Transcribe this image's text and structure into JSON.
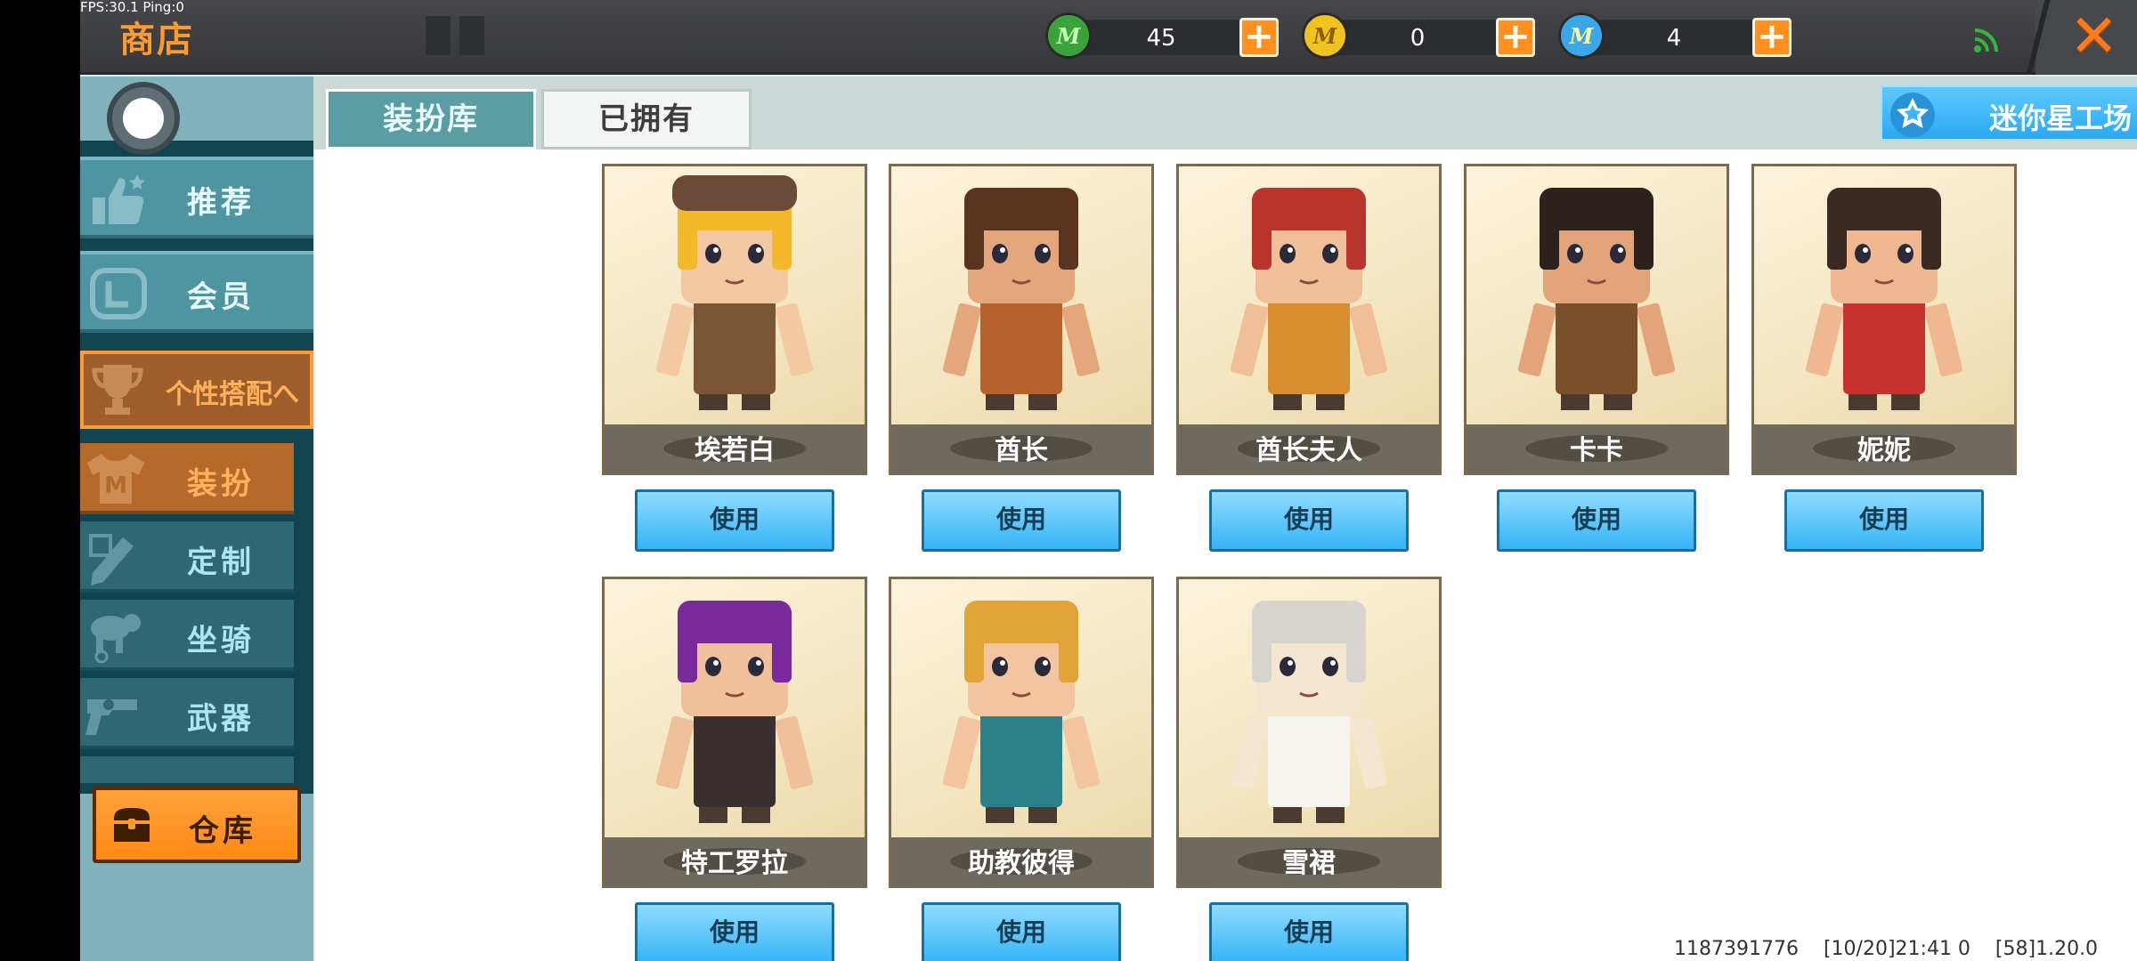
{
  "status": {
    "fps": "FPS:30.1  Ping:0"
  },
  "header": {
    "title": "商店"
  },
  "currencies": [
    {
      "icon": "green-mini-coin-icon",
      "symbol": "M",
      "value": "45",
      "color": "#3aa43a"
    },
    {
      "icon": "gold-mini-coin-icon",
      "symbol": "M",
      "value": "0",
      "color": "#f0c31e"
    },
    {
      "icon": "star-mini-coin-icon",
      "symbol": "M",
      "value": "4",
      "color": "#39a7e8"
    }
  ],
  "sidebar": {
    "recommend": "推荐",
    "member": "会员",
    "personal": "个性搭配へ",
    "sub": {
      "outfit": "装扮",
      "custom": "定制",
      "mount": "坐骑",
      "weapon": "武器"
    },
    "warehouse": "仓库"
  },
  "tabs": {
    "library": "装扮库",
    "owned": "已拥有"
  },
  "workshop": {
    "label": "迷你星工场"
  },
  "use_label": "使用",
  "skins": [
    {
      "name": "埃若白",
      "hair": "#f3b928",
      "outfit": "#7a5636",
      "skin": "#f3c9a3",
      "hat": "#6b4a3a"
    },
    {
      "name": "酋长",
      "hair": "#5a3421",
      "outfit": "#b5622c",
      "skin": "#e4a77c",
      "hat": ""
    },
    {
      "name": "酋长夫人",
      "hair": "#b8342c",
      "outfit": "#d88d2e",
      "skin": "#f0bf98",
      "hat": ""
    },
    {
      "name": "卡卡",
      "hair": "#2c221d",
      "outfit": "#7a4f2c",
      "skin": "#e4a47a",
      "hat": ""
    },
    {
      "name": "妮妮",
      "hair": "#3a2a22",
      "outfit": "#c8322e",
      "skin": "#f0b890",
      "hat": ""
    },
    {
      "name": "特工罗拉",
      "hair": "#7a2a9a",
      "outfit": "#3a2f2f",
      "skin": "#f0c09a",
      "hat": ""
    },
    {
      "name": "助教彼得",
      "hair": "#e0a438",
      "outfit": "#2b7f88",
      "skin": "#f2c5a0",
      "hat": ""
    },
    {
      "name": "雪裙",
      "hair": "#d8d4ce",
      "outfit": "#f6f4ee",
      "skin": "#f5e6d2",
      "hat": ""
    }
  ],
  "footer": {
    "uid": "1187391776",
    "time": "[10/20]21:41 0",
    "version": "[58]1.20.0"
  }
}
